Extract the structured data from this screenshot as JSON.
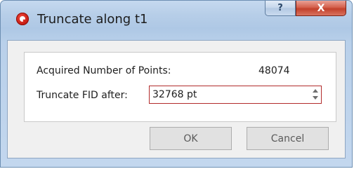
{
  "window": {
    "title": "Truncate along t1",
    "help_label": "?",
    "close_label": "X",
    "app_icon": "app-logo-icon"
  },
  "form": {
    "acquired_label": "Acquired Number of Points:",
    "acquired_value": "48074",
    "truncate_label": "Truncate FID after:",
    "truncate_value": "32768 pt"
  },
  "buttons": {
    "ok_label": "OK",
    "cancel_label": "Cancel"
  },
  "colors": {
    "accent_border": "#b22b2b",
    "titlebar": "#b7cee8",
    "close_button": "#c2402b"
  }
}
